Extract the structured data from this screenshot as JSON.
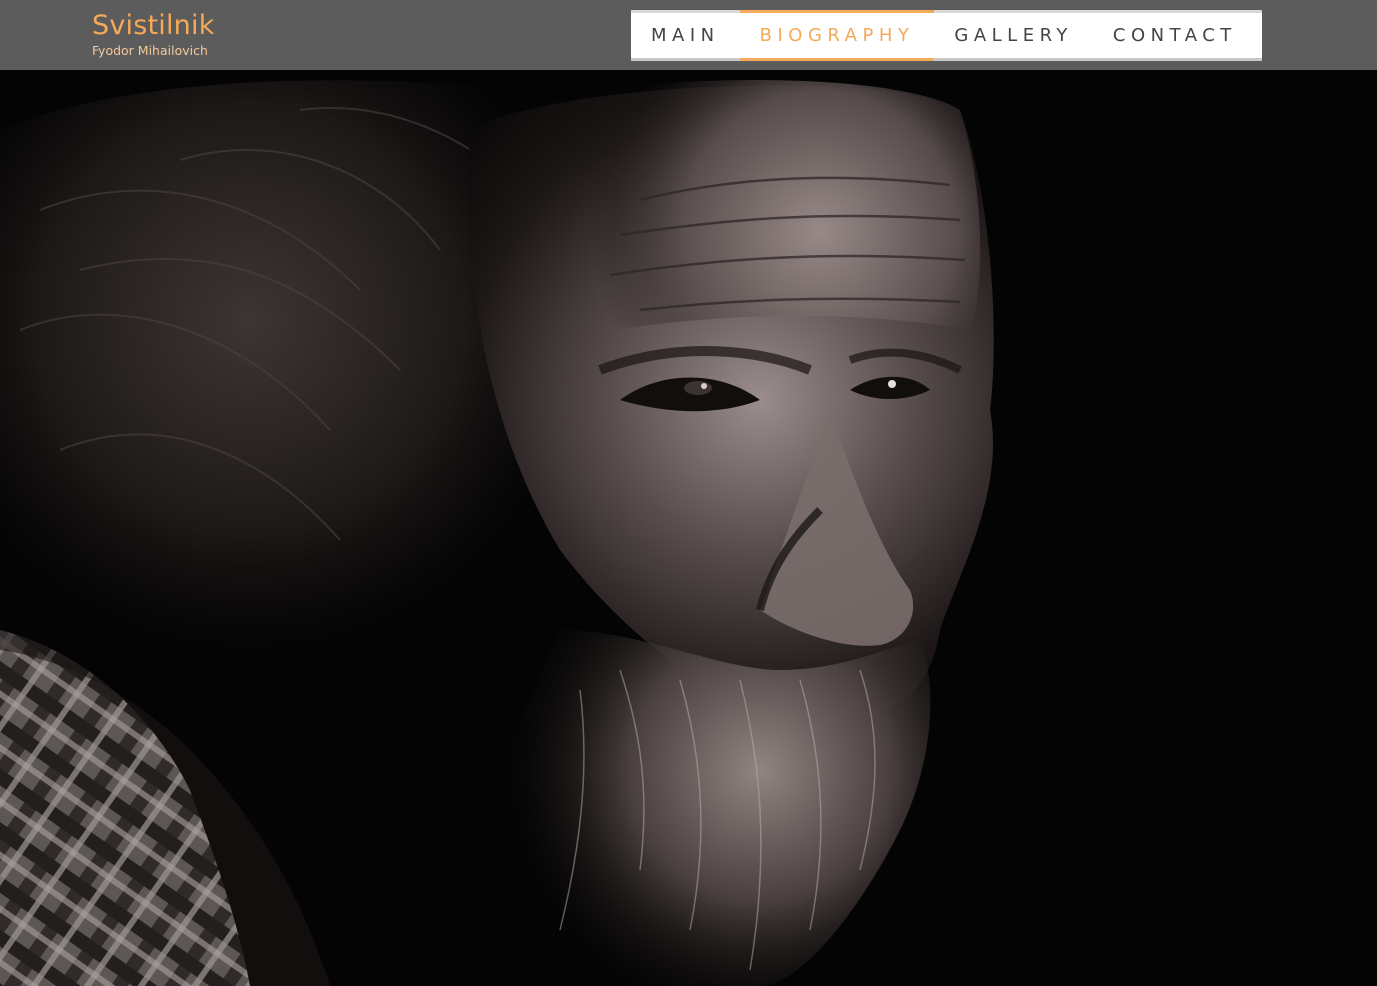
{
  "brand": {
    "title": "Svistilnik",
    "subtitle": "Fyodor Mihailovich"
  },
  "nav": {
    "items": [
      {
        "label": "MAIN",
        "active": false
      },
      {
        "label": "BIOGRAPHY",
        "active": true
      },
      {
        "label": "GALLERY",
        "active": false
      },
      {
        "label": "CONTACT",
        "active": false
      }
    ]
  },
  "colors": {
    "accent": "#f5a959",
    "header_bg": "#5c5c5c",
    "nav_bg": "#ffffff",
    "nav_text": "#444444",
    "hero_bg": "#050404"
  },
  "hero": {
    "image": "black-and-white portrait photo"
  }
}
